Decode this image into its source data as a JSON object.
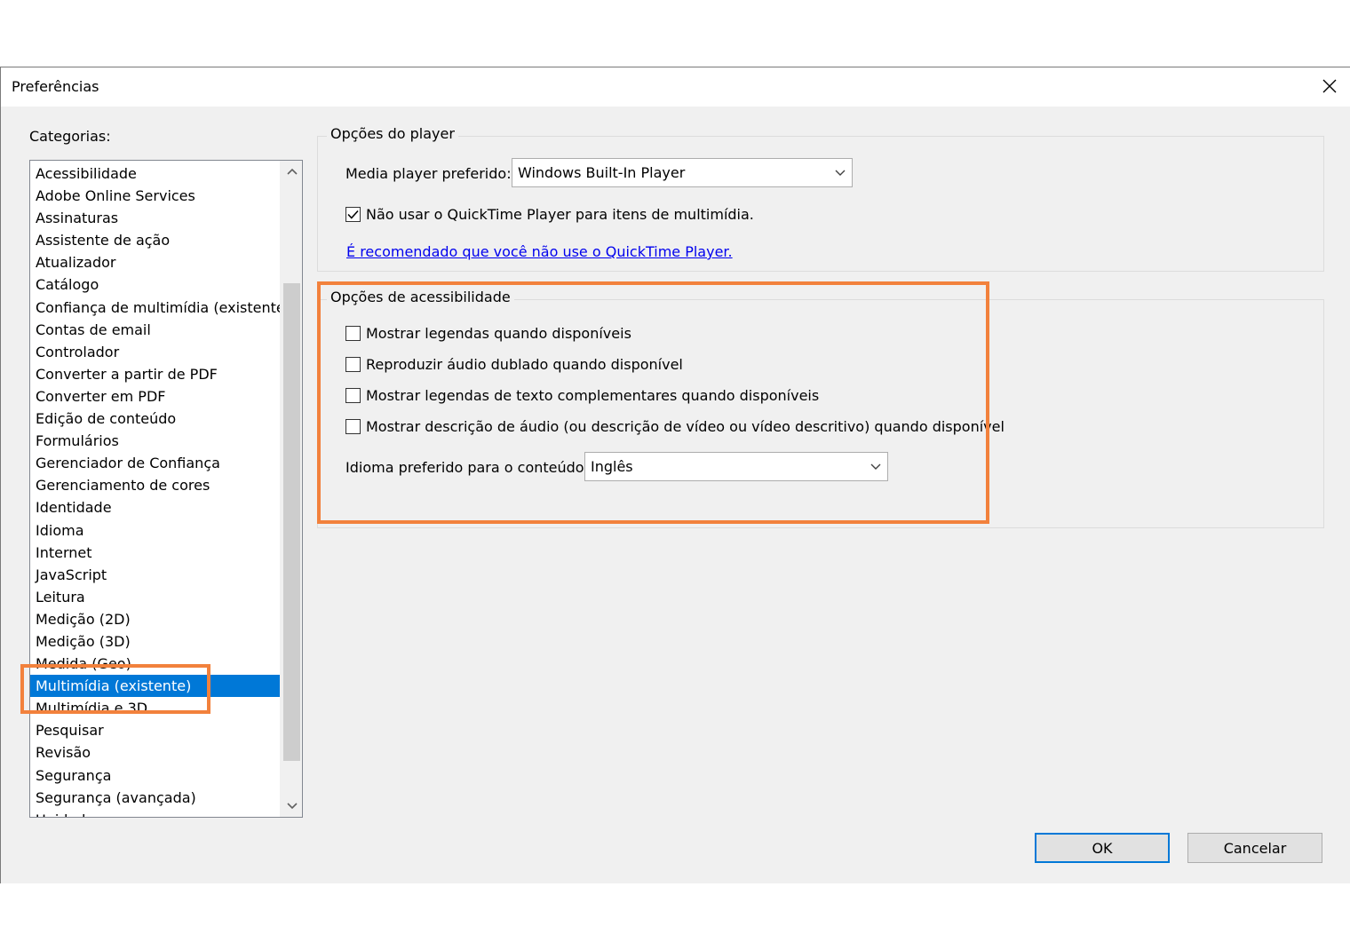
{
  "dialog": {
    "title": "Preferências"
  },
  "categories": {
    "label": "Categorias:",
    "items": [
      "Acessibilidade",
      "Adobe Online Services",
      "Assinaturas",
      "Assistente de ação",
      "Atualizador",
      "Catálogo",
      "Confiança de multimídia (existente)",
      "Contas de email",
      "Controlador",
      "Converter a partir de PDF",
      "Converter em PDF",
      "Edição de conteúdo",
      "Formulários",
      "Gerenciador de Confiança",
      "Gerenciamento de cores",
      "Identidade",
      "Idioma",
      "Internet",
      "JavaScript",
      "Leitura",
      "Medição (2D)",
      "Medição (3D)",
      "Medida (Geo)",
      "Multimídia (existente)",
      "Multimídia e 3D",
      "Pesquisar",
      "Revisão",
      "Segurança",
      "Segurança (avançada)",
      "Unidades"
    ],
    "selected": "Multimídia (existente)"
  },
  "player_options": {
    "title": "Opções do player",
    "media_player_label": "Media player preferido:",
    "media_player_value": "Windows Built-In Player",
    "quicktime_checkbox_label": "Não usar o QuickTime Player para itens de multimídia.",
    "quicktime_checked": true,
    "quicktime_link": "É recomendado que você não use o QuickTime Player."
  },
  "accessibility_options": {
    "title": "Opções de acessibilidade",
    "checkboxes": [
      {
        "label": "Mostrar legendas quando disponíveis",
        "checked": false
      },
      {
        "label": "Reproduzir áudio dublado quando disponível",
        "checked": false
      },
      {
        "label": "Mostrar legendas de texto complementares quando disponíveis",
        "checked": false
      },
      {
        "label": "Mostrar descrição de áudio (ou descrição de vídeo ou vídeo descritivo) quando disponível",
        "checked": false
      }
    ],
    "language_label": "Idioma preferido para o conteúdo:",
    "language_value": "Inglês"
  },
  "buttons": {
    "ok": "OK",
    "cancel": "Cancelar"
  },
  "colors": {
    "highlight": "#f2813c",
    "selection": "#0078d7",
    "link": "#0000ee"
  }
}
